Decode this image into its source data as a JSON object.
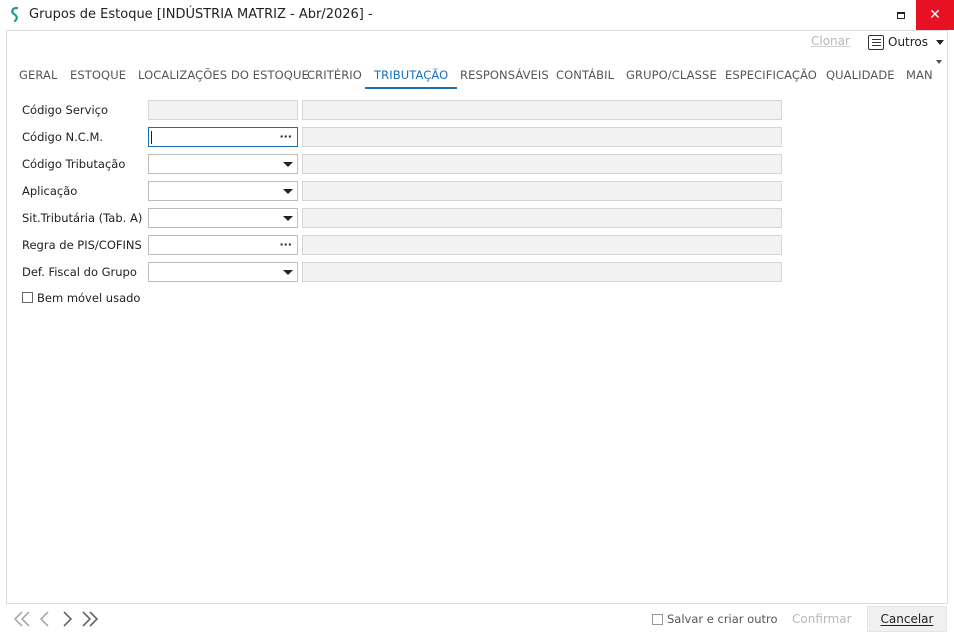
{
  "window": {
    "title": "Grupos de Estoque [INDÚSTRIA MATRIZ - Abr/2026]  -",
    "close_glyph": "✕"
  },
  "toolbar": {
    "clonar_label": "Clonar",
    "outros_label": "Outros"
  },
  "tabs": [
    {
      "label": "GERAL"
    },
    {
      "label": "ESTOQUE"
    },
    {
      "label": "LOCALIZAÇÕES DO ESTOQUE"
    },
    {
      "label": "CRITÉRIO"
    },
    {
      "label": "TRIBUTAÇÃO",
      "active": true
    },
    {
      "label": "RESPONSÁVEIS"
    },
    {
      "label": "CONTÁBIL"
    },
    {
      "label": "GRUPO/CLASSE"
    },
    {
      "label": "ESPECIFICAÇÃO"
    },
    {
      "label": "QUALIDADE"
    },
    {
      "label": "MAN"
    }
  ],
  "form": {
    "fields": [
      {
        "label": "Código Serviço",
        "code_value": "",
        "desc_value": "",
        "control": "readonly"
      },
      {
        "label": "Código N.C.M.",
        "code_value": "",
        "desc_value": "",
        "control": "lookup",
        "focused": true
      },
      {
        "label": "Código Tributação",
        "code_value": "",
        "desc_value": "",
        "control": "dropdown"
      },
      {
        "label": "Aplicação",
        "code_value": "",
        "desc_value": "",
        "control": "dropdown"
      },
      {
        "label": "Sit.Tributária (Tab. A)",
        "code_value": "",
        "desc_value": "",
        "control": "dropdown"
      },
      {
        "label": "Regra de PIS/COFINS",
        "code_value": "",
        "desc_value": "",
        "control": "lookup"
      },
      {
        "label": "Def. Fiscal do Grupo",
        "code_value": "",
        "desc_value": "",
        "control": "dropdown"
      }
    ],
    "lookup_glyph": "···",
    "bem_movel_label": "Bem móvel usado",
    "bem_movel_checked": false
  },
  "footer": {
    "salvar_label": "Salvar e criar outro",
    "salvar_checked": false,
    "confirmar_label": "Confirmar",
    "cancelar_label": "Cancelar"
  }
}
